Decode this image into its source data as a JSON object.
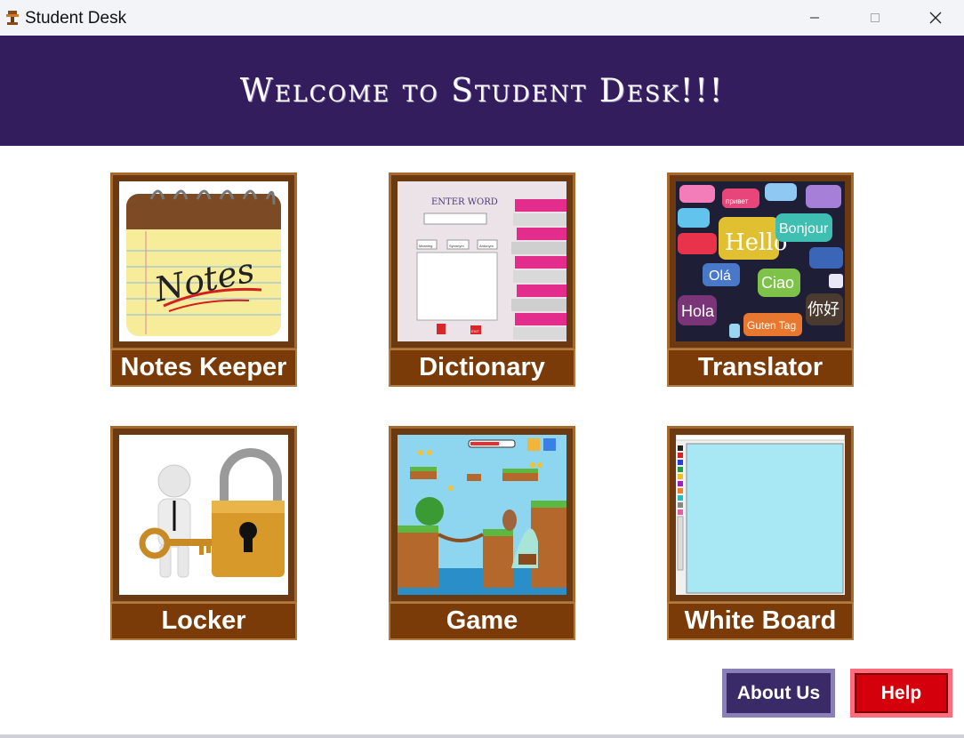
{
  "window": {
    "title": "Student Desk",
    "minimize_glyph": "—",
    "maximize_glyph": "☐",
    "close_glyph": "✕"
  },
  "banner": {
    "text": "Welcome to Student Desk!!!"
  },
  "tiles": [
    {
      "label": "Notes Keeper",
      "icon": "notes-icon"
    },
    {
      "label": "Dictionary",
      "icon": "dictionary-icon"
    },
    {
      "label": "Translator",
      "icon": "translator-icon"
    },
    {
      "label": "Locker",
      "icon": "locker-icon"
    },
    {
      "label": "Game",
      "icon": "game-icon"
    },
    {
      "label": "White Board",
      "icon": "whiteboard-icon"
    }
  ],
  "tile_art": {
    "notes_word": "Notes",
    "dict_heading": "ENTER WORD",
    "dict_tabs": [
      "Meaning",
      "Synonym",
      "Antonym"
    ],
    "dict_exit": "EXIT",
    "translator_words": [
      "Hello",
      "Bonjour",
      "Olá",
      "Ciao",
      "Hola",
      "你好",
      "Guten Tag",
      "привет"
    ]
  },
  "buttons": {
    "about": "About Us",
    "help": "Help"
  },
  "colors": {
    "banner": "#331d5c",
    "tile_label": "#7a3b08",
    "about_bg": "#3b2a68",
    "help_bg": "#d4000c"
  }
}
